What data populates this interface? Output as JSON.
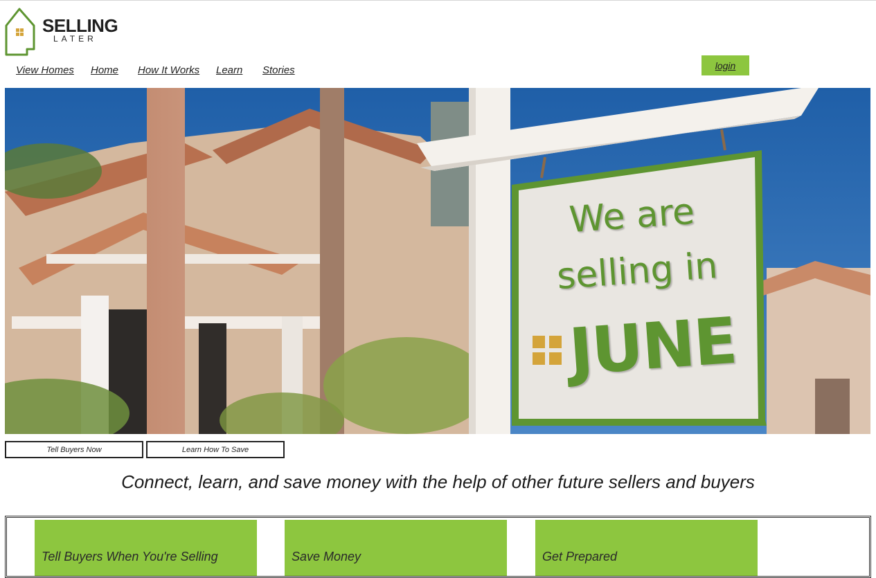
{
  "brand": {
    "name_top": "SELLING",
    "name_bottom": "LATER",
    "logo_icon": "house-icon"
  },
  "nav": {
    "items": [
      {
        "label": "View Homes"
      },
      {
        "label": "Home"
      },
      {
        "label": "How It Works"
      },
      {
        "label": "Learn"
      },
      {
        "label": "Stories"
      }
    ],
    "login_label": "login"
  },
  "hero": {
    "sign_line1": "We are",
    "sign_line2": "selling in",
    "sign_month": "JUNE"
  },
  "actions": {
    "tell_buyers": "Tell Buyers Now",
    "learn_save": "Learn How To Save"
  },
  "tagline": "Connect, learn, and save money with the help of other future sellers and buyers",
  "features": [
    {
      "title": "Tell Buyers When You're Selling"
    },
    {
      "title": "Save Money"
    },
    {
      "title": "Get Prepared"
    }
  ],
  "colors": {
    "accent": "#8dc63f",
    "sign_green": "#5e9531",
    "gold": "#d4a43a",
    "sky": "#2f6fb4"
  }
}
